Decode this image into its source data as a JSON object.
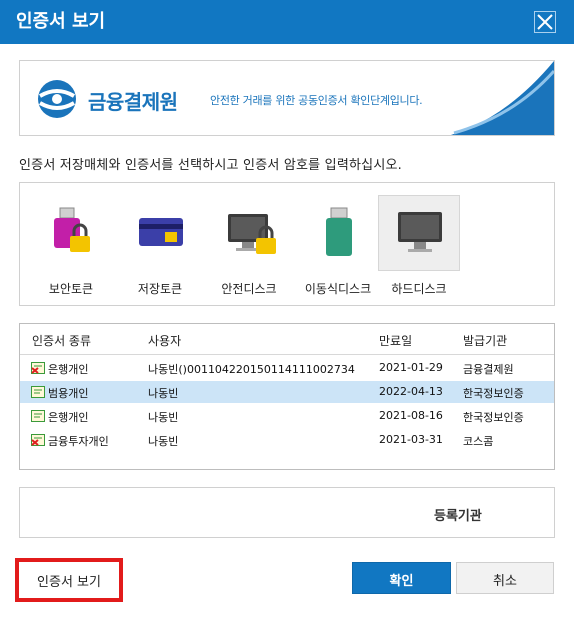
{
  "window": {
    "title": "인증서 보기"
  },
  "banner": {
    "brand": "금융결제원",
    "tagline": "안전한 거래를 위한 공동인증서 확인단계입니다."
  },
  "instruction": "인증서 저장매체와 인증서를 선택하시고 인증서 암호를 입력하십시오.",
  "media": {
    "selected": "hard-disk",
    "items": [
      {
        "label": "보안토큰",
        "icon": "security-token-icon"
      },
      {
        "label": "저장토큰",
        "icon": "storage-token-icon"
      },
      {
        "label": "안전디스크",
        "icon": "secure-disk-icon"
      },
      {
        "label": "이동식디스크",
        "icon": "removable-disk-icon"
      },
      {
        "label": "하드디스크",
        "icon": "hard-disk-icon"
      }
    ]
  },
  "table": {
    "headers": [
      "인증서 종류",
      "사용자",
      "만료일",
      "발급기관"
    ],
    "rows": [
      {
        "type": "은행개인",
        "user": "나동빈()0011042201501141110027​34",
        "expiry": "2021-01-29",
        "issuer": "금융결제원",
        "status": "expired",
        "selected": false
      },
      {
        "type": "범용개인",
        "user": "나동빈",
        "expiry": "2022-04-13",
        "issuer": "한국정보인증",
        "status": "valid",
        "selected": true
      },
      {
        "type": "은행개인",
        "user": "나동빈",
        "expiry": "2021-08-16",
        "issuer": "한국정보인증",
        "status": "valid",
        "selected": false
      },
      {
        "type": "금융투자개인",
        "user": "나동빈",
        "expiry": "2021-03-31",
        "issuer": "코스콤",
        "status": "expired",
        "selected": false
      }
    ]
  },
  "issuer_box": {
    "label": "등록기관"
  },
  "buttons": {
    "view": "인증서 보기",
    "ok": "확인",
    "cancel": "취소"
  },
  "colors": {
    "accent": "#1177c2",
    "selected_row": "#cce4f7",
    "highlight_border": "#e21b1b"
  }
}
